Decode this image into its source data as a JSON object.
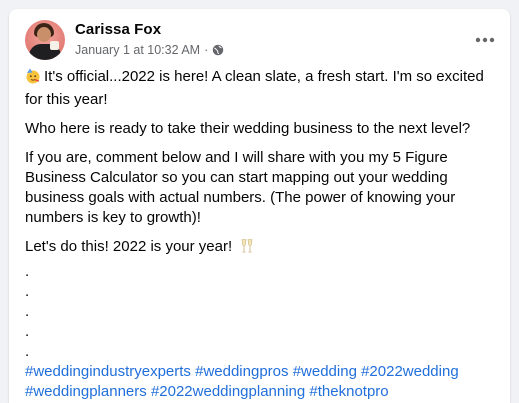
{
  "post": {
    "author": "Carissa Fox",
    "timestamp": "January 1 at 10:32 AM",
    "separator": "·",
    "privacy_icon": "globe-icon",
    "more_icon": "more-horizontal-icon",
    "paragraphs": {
      "p1": "It's official...2022 is here! A clean slate, a fresh start. I'm so excited for this year!",
      "p2": "Who here is ready to take their wedding business to the next level?",
      "p3": "If you are, comment below and I will share with you my 5 Figure Business Calculator so you can start mapping out your wedding business goals with actual numbers. (The power of knowing your numbers is key to growth)!",
      "p4": "Let's do this! 2022 is your year!"
    },
    "dots": [
      ".",
      ".",
      ".",
      ".",
      "."
    ],
    "hashtags": {
      "h1": "#weddingindustryexperts",
      "h2": "#weddingpros",
      "h3": "#wedding",
      "h4": "#2022wedding",
      "h5": "#weddingplanners",
      "h6": "#2022weddingplanning",
      "h7": "#theknotpro"
    },
    "emojis": {
      "party_face": "partying-face-emoji",
      "champagne": "clinking-glasses-emoji"
    },
    "colors": {
      "hashtag": "#216fdb",
      "text": "#050505",
      "meta": "#65676b",
      "background": "#f0f2f5"
    }
  }
}
